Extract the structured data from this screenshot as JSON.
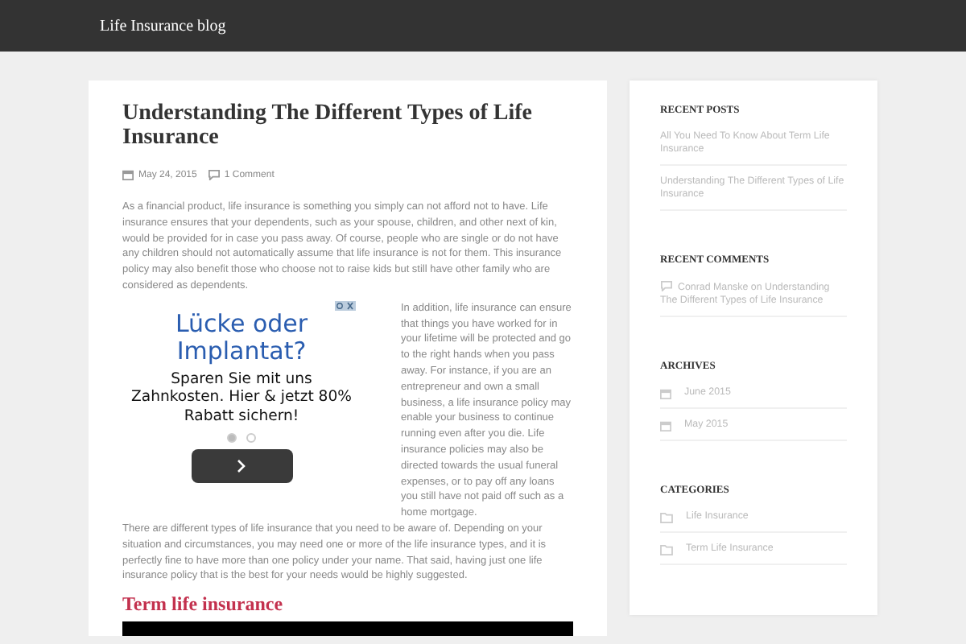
{
  "header": {
    "site_title": "Life Insurance blog"
  },
  "post": {
    "title": "Understanding The Different Types of Life Insurance",
    "date": "May 24, 2015",
    "comments": "1 Comment",
    "intro": "As a financial product, life insurance is something you simply can not afford not to have. Life insurance ensures that your dependents, such as your spouse, children, and other next of kin, would be provided for in case you pass away. Of course, people who are single or do not have any children should not automatically assume that life insurance is not for them. This insurance policy may also benefit those who choose not to raise kids but still have other family who are considered as dependents.",
    "ad": {
      "headline": "Lücke oder Implantat?",
      "body": "Sparen Sie mit uns Zahnkosten. Hier & jetzt 80% Rabatt sichern!",
      "dots": [
        {
          "selected": true
        },
        {
          "selected": false
        }
      ]
    },
    "wrapped": [
      "In addition, life insurance can ensure that things you have worked for in your lifetime will be protected and go to the right hands when you pass away. For instance, if you are an entrepreneur and own a small business, a life insurance policy may enable your business to continue running even after you die. Life insurance policies may also be directed towards the usual funeral expenses, or to pay off any loans you still have not paid off such as a home mortgage.",
      "There are different types of life insurance that you need to be aware of. Depending on your situation and circumstances, you may need one or more of the life insurance types, and it is perfectly fine to have more than one policy under your name. That said, having just one life insurance policy that is the best for your needs would be highly suggested."
    ],
    "subheading": "Term life insurance"
  },
  "sidebar": [
    {
      "title": "RECENT POSTS",
      "kind": "posts",
      "items": [
        "All You Need To Know About Term Life Insurance",
        "Understanding The Different Types of Life Insurance"
      ]
    },
    {
      "title": "RECENT COMMENTS",
      "kind": "comments",
      "items": [
        "Conrad Manske on Understanding The Different Types of Life Insurance"
      ]
    },
    {
      "title": "ARCHIVES",
      "kind": "archives",
      "items": [
        "June 2015",
        "May 2015"
      ]
    },
    {
      "title": "CATEGORIES",
      "kind": "categories",
      "items": [
        "Life Insurance",
        "Term Life Insurance"
      ]
    }
  ]
}
